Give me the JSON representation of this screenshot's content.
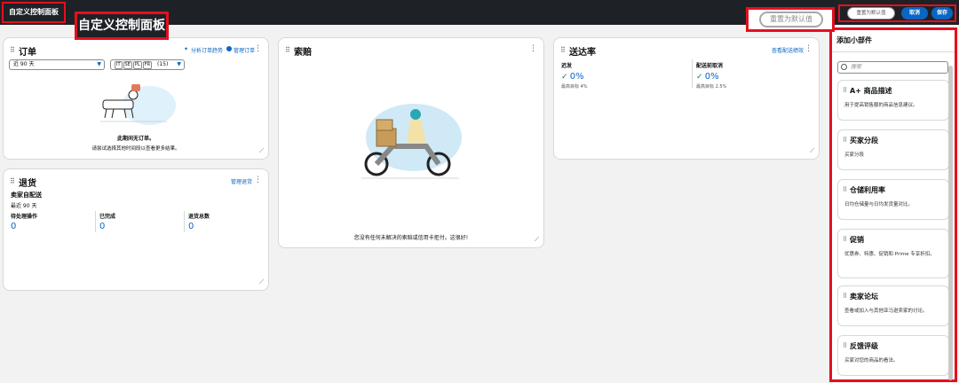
{
  "header": {
    "title": "自定义控制面板",
    "callout_title": "自定义控制面板",
    "callout_reset": "重置为默认值",
    "reset_label": "重置为默认值",
    "cancel_label": "取消",
    "save_label": "保存"
  },
  "orders": {
    "title": "订单",
    "trend_link": "分析订单趋势",
    "manage_link": "管理订单",
    "period": "近 90 天",
    "marketplaces": [
      "IT",
      "SE",
      "PL",
      "FR"
    ],
    "count": "(15)",
    "empty_title": "此期间无订单。",
    "empty_hint": "请尝试选择其他时间段以查看更多结果。"
  },
  "claims": {
    "title": "索赔",
    "empty_message": "您没有任何未解决的索赔或信用卡拒付。这很好!"
  },
  "delivery": {
    "title": "送达率",
    "link": "查看配送绩效",
    "metrics": [
      {
        "label": "迟发",
        "value": "0%",
        "target": "最高目标 4%"
      },
      {
        "label": "配送前取消",
        "value": "0%",
        "target": "最高目标 2.5%"
      }
    ]
  },
  "returns": {
    "title": "退货",
    "manage_link": "管理退货",
    "subtitle": "卖家自配送",
    "period": "最近 90 天",
    "stats": [
      {
        "label": "待处理操作",
        "value": "0"
      },
      {
        "label": "已完成",
        "value": "0"
      },
      {
        "label": "退货总数",
        "value": "0"
      }
    ]
  },
  "panel": {
    "title": "添加小部件",
    "search_placeholder": "搜索",
    "widgets": [
      {
        "name": "A+ 商品描述",
        "desc": "用于提高销售额的商品信息建议。"
      },
      {
        "name": "买家分段",
        "desc": "买家分段"
      },
      {
        "name": "仓储利用率",
        "desc": "日均仓储量与日均发货量对比。"
      },
      {
        "name": "促销",
        "desc": "优惠券、特惠、促销和 Prime 专享折扣。"
      },
      {
        "name": "卖家论坛",
        "desc": "查看或加入与其他亚马逊卖家的讨论。"
      },
      {
        "name": "反馈评级",
        "desc": "买家对您的商品的看法。"
      }
    ]
  },
  "colors": {
    "accent": "#0a66c2",
    "highlight": "#e3101e",
    "header_bg": "#1e2227",
    "success": "#067d62"
  }
}
